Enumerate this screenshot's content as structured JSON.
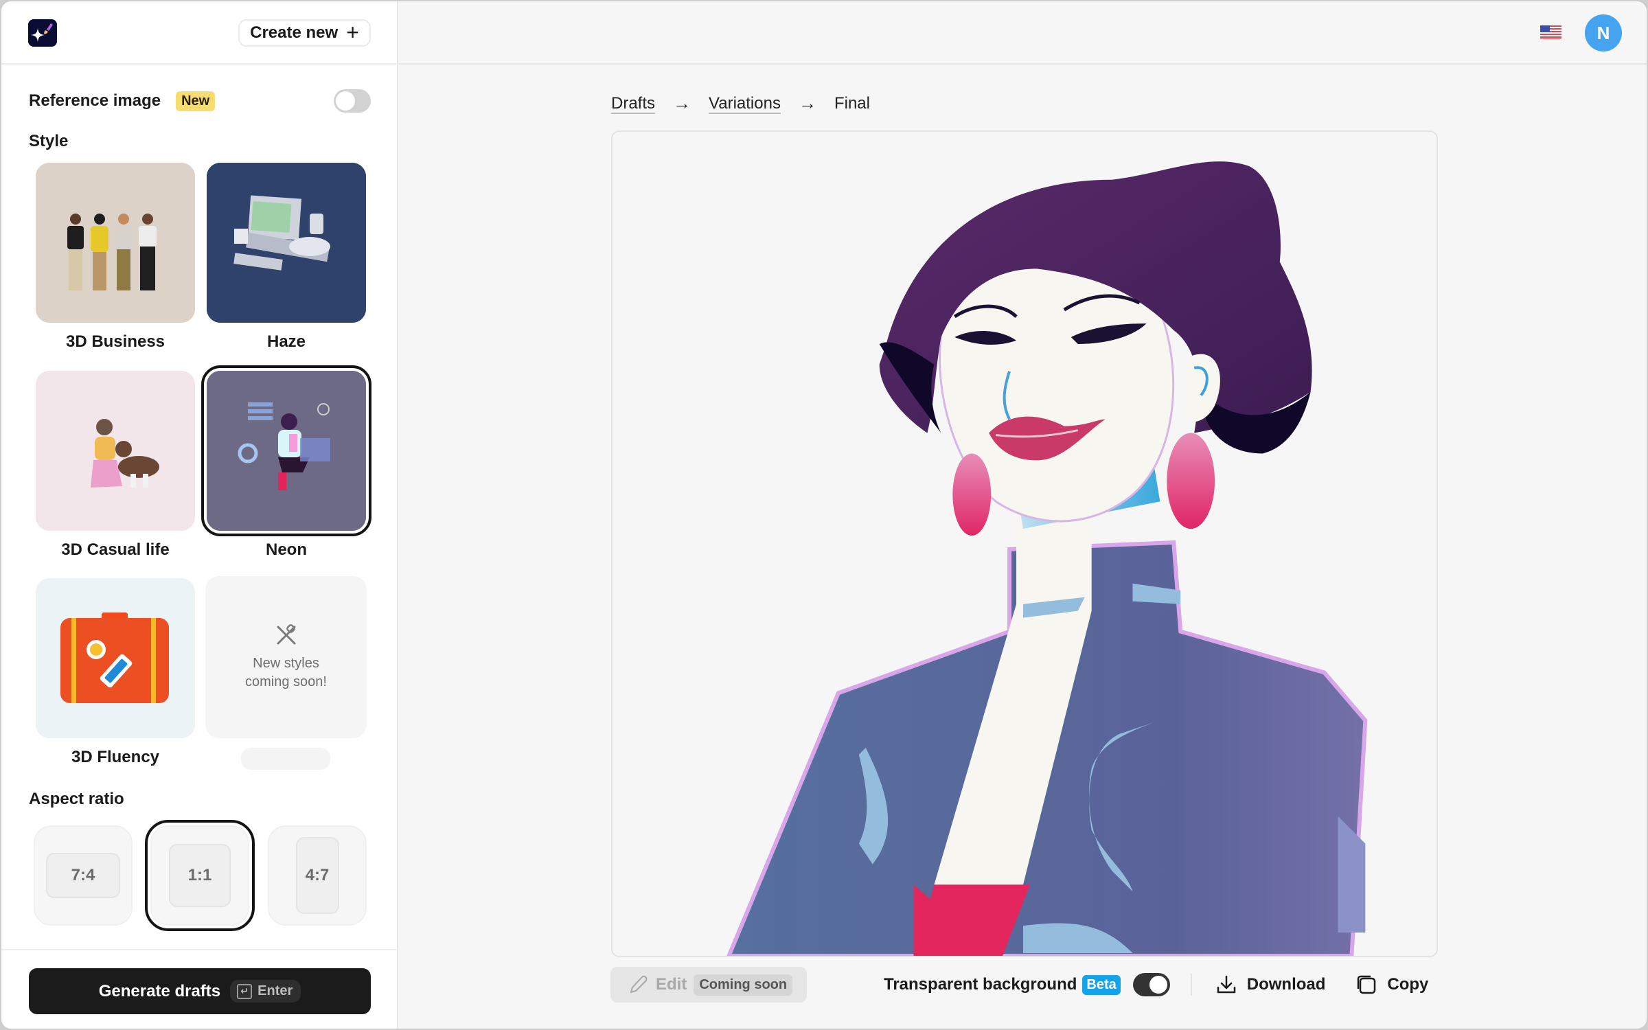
{
  "header": {
    "app_logo": "sparkle-brush-logo",
    "create_new_label": "Create new",
    "create_new_icon": "+",
    "language_flag": "us-flag",
    "avatar_initial": "N"
  },
  "sidebar": {
    "reference_image": {
      "label": "Reference image",
      "badge": "New",
      "enabled": false
    },
    "style_title": "Style",
    "styles": [
      {
        "label": "3D Business",
        "selected": false,
        "bg": "#dcd2c8"
      },
      {
        "label": "Haze",
        "selected": false,
        "bg": "#2e426c"
      },
      {
        "label": "3D Casual life",
        "selected": false,
        "bg": "#f3e6ea"
      },
      {
        "label": "Neon",
        "selected": true,
        "bg": "#6d6a86"
      },
      {
        "label": "3D Fluency",
        "selected": false,
        "bg": "#ecf3f6"
      },
      {
        "label": "",
        "coming_soon_text": "New styles coming soon!",
        "coming_soon_line1": "New styles",
        "coming_soon_line2": "coming soon!"
      }
    ],
    "aspect_title": "Aspect ratio",
    "aspect_ratios": [
      {
        "label": "7:4",
        "selected": false
      },
      {
        "label": "1:1",
        "selected": true
      },
      {
        "label": "4:7",
        "selected": false
      }
    ],
    "generate_button": {
      "label": "Generate drafts",
      "shortcut": "Enter",
      "shortcut_icon": "↵"
    }
  },
  "main": {
    "breadcrumb": [
      {
        "label": "Drafts",
        "link": true
      },
      {
        "label": "Variations",
        "link": true
      },
      {
        "label": "Final",
        "link": false
      }
    ],
    "breadcrumb_separator": "→",
    "toolbar": {
      "edit_label": "Edit",
      "edit_badge": "Coming soon",
      "transparent_label": "Transparent background",
      "transparent_badge": "Beta",
      "transparent_enabled": true,
      "download_label": "Download",
      "copy_label": "Copy"
    }
  },
  "colors": {
    "accent_dark": "#1b1b1b",
    "avatar_blue": "#46a3ef",
    "beta_blue": "#14a3e6",
    "new_badge_yellow": "#f7dc6f"
  }
}
